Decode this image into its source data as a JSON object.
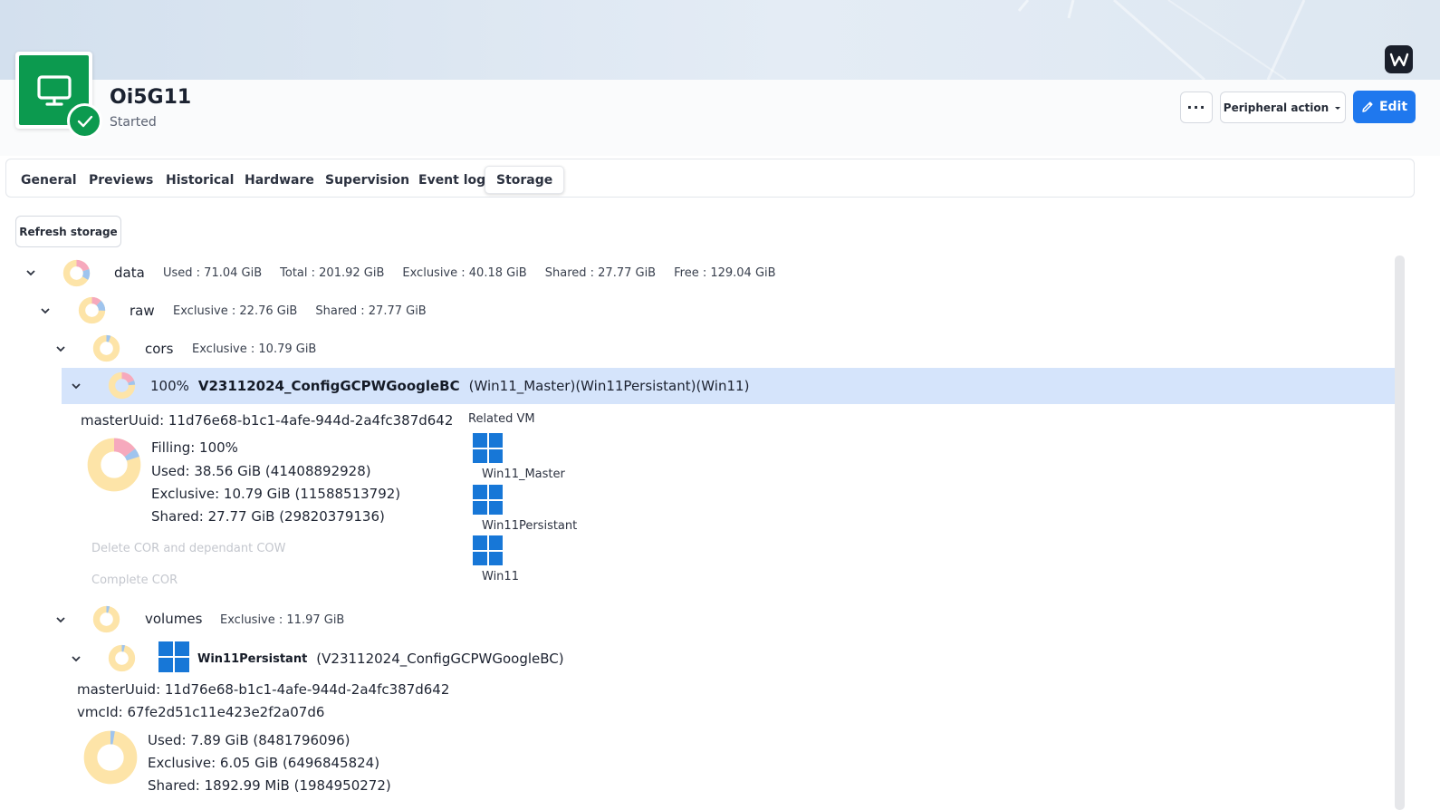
{
  "header": {
    "vm_name": "Oi5G11",
    "vm_status": "Started",
    "more_label": "···",
    "peripheral_label": "Peripheral action",
    "edit_label": "Edit"
  },
  "tabs": [
    {
      "label": "General"
    },
    {
      "label": "Previews"
    },
    {
      "label": "Historical"
    },
    {
      "label": "Hardware"
    },
    {
      "label": "Supervision"
    },
    {
      "label": "Event log"
    },
    {
      "label": "Storage",
      "active": true
    }
  ],
  "refresh_label": "Refresh storage",
  "tree": {
    "data": {
      "name": "data",
      "used": "Used : 71.04 GiB",
      "total": "Total : 201.92 GiB",
      "exclusive": "Exclusive : 40.18 GiB",
      "shared": "Shared : 27.77 GiB",
      "free": "Free : 129.04 GiB"
    },
    "raw": {
      "name": "raw",
      "exclusive": "Exclusive : 22.76 GiB",
      "shared": "Shared : 27.77 GiB"
    },
    "cors": {
      "name": "cors",
      "exclusive": "Exclusive : 10.79 GiB"
    },
    "cor_item": {
      "percent": "100%",
      "name": "V23112024_ConfigGCPWGoogleBC",
      "tags": "(Win11_Master)(Win11Persistant)(Win11)",
      "master_uuid": "masterUuid: 11d76e68-b1c1-4afe-944d-2a4fc387d642",
      "related_vm_label": "Related VM",
      "filling": "Filling: 100%",
      "used": "Used: 38.56 GiB (41408892928)",
      "exclusive": "Exclusive: 10.79 GiB (11588513792)",
      "shared": "Shared: 27.77 GiB (29820379136)",
      "delete_action": "Delete COR and dependant COW",
      "complete_action": "Complete COR",
      "related_vms": [
        "Win11_Master",
        "Win11Persistant",
        "Win11"
      ]
    },
    "volumes": {
      "name": "volumes",
      "exclusive": "Exclusive : 11.97 GiB"
    },
    "volume_item": {
      "name": "Win11Persistant",
      "parent": "(V23112024_ConfigGCPWGoogleBC)",
      "master_uuid": "masterUuid: 11d76e68-b1c1-4afe-944d-2a4fc387d642",
      "vm_id": "vmcId: 67fe2d51c11e423e2f2a07d6",
      "used": "Used: 7.89 GiB (8481796096)",
      "exclusive": "Exclusive: 6.05 GiB (6496845824)",
      "shared": "Shared: 1892.99 MiB (1984950272)"
    }
  },
  "colors": {
    "accent": "#1f78ee",
    "vm_green": "#0c9a4f",
    "selected_row": "#d5e4fb",
    "donut_free": "#fde4a8",
    "donut_exclusive": "#f6a9bd",
    "donut_shared": "#9fc4ee",
    "windows_blue": "#1777d7"
  },
  "icons": [
    "monitor-icon",
    "check-icon",
    "pencil-icon",
    "caret-down-icon",
    "chevron-down-icon",
    "windows-icon",
    "donut-icon",
    "brand-logo-icon"
  ]
}
